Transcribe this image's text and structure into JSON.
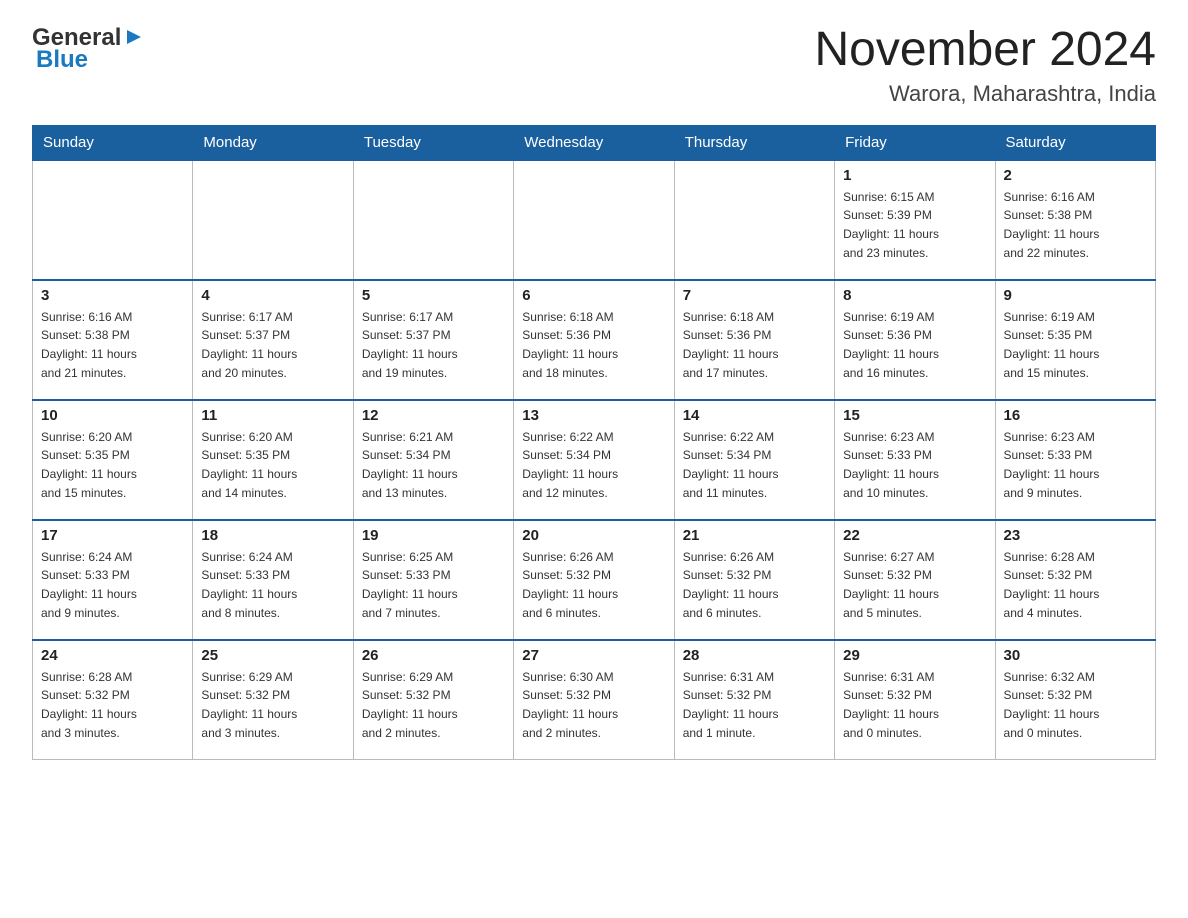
{
  "header": {
    "logo_line1": "General",
    "logo_line2": "Blue",
    "month_title": "November 2024",
    "location": "Warora, Maharashtra, India"
  },
  "weekdays": [
    "Sunday",
    "Monday",
    "Tuesday",
    "Wednesday",
    "Thursday",
    "Friday",
    "Saturday"
  ],
  "weeks": [
    [
      {
        "day": "",
        "info": ""
      },
      {
        "day": "",
        "info": ""
      },
      {
        "day": "",
        "info": ""
      },
      {
        "day": "",
        "info": ""
      },
      {
        "day": "",
        "info": ""
      },
      {
        "day": "1",
        "info": "Sunrise: 6:15 AM\nSunset: 5:39 PM\nDaylight: 11 hours\nand 23 minutes."
      },
      {
        "day": "2",
        "info": "Sunrise: 6:16 AM\nSunset: 5:38 PM\nDaylight: 11 hours\nand 22 minutes."
      }
    ],
    [
      {
        "day": "3",
        "info": "Sunrise: 6:16 AM\nSunset: 5:38 PM\nDaylight: 11 hours\nand 21 minutes."
      },
      {
        "day": "4",
        "info": "Sunrise: 6:17 AM\nSunset: 5:37 PM\nDaylight: 11 hours\nand 20 minutes."
      },
      {
        "day": "5",
        "info": "Sunrise: 6:17 AM\nSunset: 5:37 PM\nDaylight: 11 hours\nand 19 minutes."
      },
      {
        "day": "6",
        "info": "Sunrise: 6:18 AM\nSunset: 5:36 PM\nDaylight: 11 hours\nand 18 minutes."
      },
      {
        "day": "7",
        "info": "Sunrise: 6:18 AM\nSunset: 5:36 PM\nDaylight: 11 hours\nand 17 minutes."
      },
      {
        "day": "8",
        "info": "Sunrise: 6:19 AM\nSunset: 5:36 PM\nDaylight: 11 hours\nand 16 minutes."
      },
      {
        "day": "9",
        "info": "Sunrise: 6:19 AM\nSunset: 5:35 PM\nDaylight: 11 hours\nand 15 minutes."
      }
    ],
    [
      {
        "day": "10",
        "info": "Sunrise: 6:20 AM\nSunset: 5:35 PM\nDaylight: 11 hours\nand 15 minutes."
      },
      {
        "day": "11",
        "info": "Sunrise: 6:20 AM\nSunset: 5:35 PM\nDaylight: 11 hours\nand 14 minutes."
      },
      {
        "day": "12",
        "info": "Sunrise: 6:21 AM\nSunset: 5:34 PM\nDaylight: 11 hours\nand 13 minutes."
      },
      {
        "day": "13",
        "info": "Sunrise: 6:22 AM\nSunset: 5:34 PM\nDaylight: 11 hours\nand 12 minutes."
      },
      {
        "day": "14",
        "info": "Sunrise: 6:22 AM\nSunset: 5:34 PM\nDaylight: 11 hours\nand 11 minutes."
      },
      {
        "day": "15",
        "info": "Sunrise: 6:23 AM\nSunset: 5:33 PM\nDaylight: 11 hours\nand 10 minutes."
      },
      {
        "day": "16",
        "info": "Sunrise: 6:23 AM\nSunset: 5:33 PM\nDaylight: 11 hours\nand 9 minutes."
      }
    ],
    [
      {
        "day": "17",
        "info": "Sunrise: 6:24 AM\nSunset: 5:33 PM\nDaylight: 11 hours\nand 9 minutes."
      },
      {
        "day": "18",
        "info": "Sunrise: 6:24 AM\nSunset: 5:33 PM\nDaylight: 11 hours\nand 8 minutes."
      },
      {
        "day": "19",
        "info": "Sunrise: 6:25 AM\nSunset: 5:33 PM\nDaylight: 11 hours\nand 7 minutes."
      },
      {
        "day": "20",
        "info": "Sunrise: 6:26 AM\nSunset: 5:32 PM\nDaylight: 11 hours\nand 6 minutes."
      },
      {
        "day": "21",
        "info": "Sunrise: 6:26 AM\nSunset: 5:32 PM\nDaylight: 11 hours\nand 6 minutes."
      },
      {
        "day": "22",
        "info": "Sunrise: 6:27 AM\nSunset: 5:32 PM\nDaylight: 11 hours\nand 5 minutes."
      },
      {
        "day": "23",
        "info": "Sunrise: 6:28 AM\nSunset: 5:32 PM\nDaylight: 11 hours\nand 4 minutes."
      }
    ],
    [
      {
        "day": "24",
        "info": "Sunrise: 6:28 AM\nSunset: 5:32 PM\nDaylight: 11 hours\nand 3 minutes."
      },
      {
        "day": "25",
        "info": "Sunrise: 6:29 AM\nSunset: 5:32 PM\nDaylight: 11 hours\nand 3 minutes."
      },
      {
        "day": "26",
        "info": "Sunrise: 6:29 AM\nSunset: 5:32 PM\nDaylight: 11 hours\nand 2 minutes."
      },
      {
        "day": "27",
        "info": "Sunrise: 6:30 AM\nSunset: 5:32 PM\nDaylight: 11 hours\nand 2 minutes."
      },
      {
        "day": "28",
        "info": "Sunrise: 6:31 AM\nSunset: 5:32 PM\nDaylight: 11 hours\nand 1 minute."
      },
      {
        "day": "29",
        "info": "Sunrise: 6:31 AM\nSunset: 5:32 PM\nDaylight: 11 hours\nand 0 minutes."
      },
      {
        "day": "30",
        "info": "Sunrise: 6:32 AM\nSunset: 5:32 PM\nDaylight: 11 hours\nand 0 minutes."
      }
    ]
  ]
}
